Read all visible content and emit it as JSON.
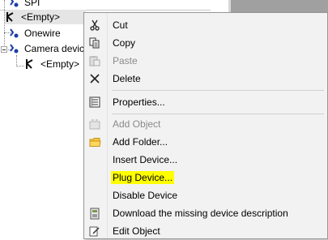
{
  "tree": {
    "items": [
      {
        "label": "SPI"
      },
      {
        "label": "<Empty>"
      },
      {
        "label": "Onewire"
      },
      {
        "label": "Camera device"
      },
      {
        "label": "<Empty>"
      }
    ]
  },
  "menu": {
    "items": [
      {
        "label": "Cut",
        "icon": "scissors-icon",
        "disabled": false
      },
      {
        "label": "Copy",
        "icon": "copy-icon",
        "disabled": false
      },
      {
        "label": "Paste",
        "icon": "paste-icon",
        "disabled": true
      },
      {
        "label": "Delete",
        "icon": "delete-x-icon",
        "disabled": false
      },
      {
        "label": "Properties...",
        "icon": "properties-icon",
        "disabled": false
      },
      {
        "label": "Add Object",
        "icon": "add-object-icon",
        "disabled": true
      },
      {
        "label": "Add Folder...",
        "icon": "folder-icon",
        "disabled": false
      },
      {
        "label": "Insert Device...",
        "icon": "",
        "disabled": false
      },
      {
        "label": "Plug Device...",
        "icon": "",
        "disabled": false
      },
      {
        "label": "Disable Device",
        "icon": "",
        "disabled": false
      },
      {
        "label": "Download the missing device description",
        "icon": "download-icon",
        "disabled": false
      },
      {
        "label": "Edit Object",
        "icon": "edit-object-icon",
        "disabled": false
      }
    ],
    "highlight_color": "#ffff00"
  }
}
